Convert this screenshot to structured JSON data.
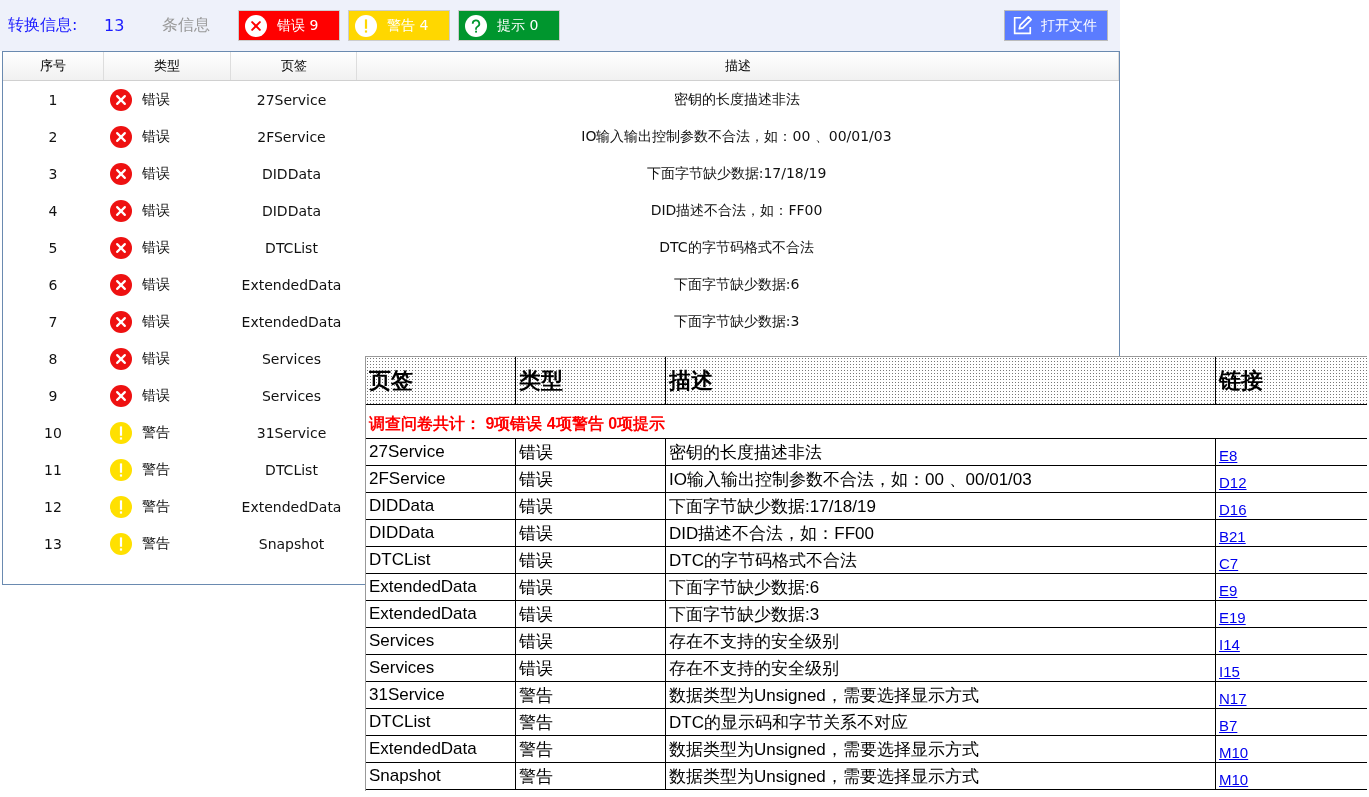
{
  "toolbar": {
    "label": "转换信息:",
    "count": "13",
    "count_label": "条信息",
    "badges": [
      {
        "kind": "error",
        "label": "错误 9"
      },
      {
        "kind": "warning",
        "label": "警告 4"
      },
      {
        "kind": "info",
        "label": "提示 0"
      }
    ],
    "open_button": "打开文件"
  },
  "table": {
    "columns": [
      "序号",
      "类型",
      "页签",
      "描述"
    ],
    "rows": [
      {
        "index": "1",
        "kind": "error",
        "type": "错误",
        "tab": "27Service",
        "description": "密钥的长度描述非法"
      },
      {
        "index": "2",
        "kind": "error",
        "type": "错误",
        "tab": "2FService",
        "description": "IO输入输出控制参数不合法，如：00 、00/01/03"
      },
      {
        "index": "3",
        "kind": "error",
        "type": "错误",
        "tab": "DIDData",
        "description": "下面字节缺少数据:17/18/19"
      },
      {
        "index": "4",
        "kind": "error",
        "type": "错误",
        "tab": "DIDData",
        "description": "DID描述不合法，如：FF00"
      },
      {
        "index": "5",
        "kind": "error",
        "type": "错误",
        "tab": "DTCList",
        "description": "DTC的字节码格式不合法"
      },
      {
        "index": "6",
        "kind": "error",
        "type": "错误",
        "tab": "ExtendedData",
        "description": "下面字节缺少数据:6"
      },
      {
        "index": "7",
        "kind": "error",
        "type": "错误",
        "tab": "ExtendedData",
        "description": "下面字节缺少数据:3"
      },
      {
        "index": "8",
        "kind": "error",
        "type": "错误",
        "tab": "Services"
      },
      {
        "index": "9",
        "kind": "error",
        "type": "错误",
        "tab": "Services"
      },
      {
        "index": "10",
        "kind": "warning",
        "type": "警告",
        "tab": "31Service"
      },
      {
        "index": "11",
        "kind": "warning",
        "type": "警告",
        "tab": "DTCList"
      },
      {
        "index": "12",
        "kind": "warning",
        "type": "警告",
        "tab": "ExtendedData"
      },
      {
        "index": "13",
        "kind": "warning",
        "type": "警告",
        "tab": "Snapshot"
      }
    ]
  },
  "sheet": {
    "columns": [
      "页签",
      "类型",
      "描述",
      "链接"
    ],
    "summary": "调查问卷共计： 9项错误 4项警告 0项提示",
    "rows": [
      {
        "tab": "27Service",
        "type": "错误",
        "description": "密钥的长度描述非法",
        "link": "E8"
      },
      {
        "tab": "2FService",
        "type": "错误",
        "description": "IO输入输出控制参数不合法，如：00 、00/01/03",
        "link": "D12"
      },
      {
        "tab": "DIDData",
        "type": "错误",
        "description": "下面字节缺少数据:17/18/19",
        "link": "D16"
      },
      {
        "tab": "DIDData",
        "type": "错误",
        "description": "DID描述不合法，如：FF00",
        "link": "B21"
      },
      {
        "tab": "DTCList",
        "type": "错误",
        "description": "DTC的字节码格式不合法",
        "link": "C7"
      },
      {
        "tab": "ExtendedData",
        "type": "错误",
        "description": "下面字节缺少数据:6",
        "link": "E9"
      },
      {
        "tab": "ExtendedData",
        "type": "错误",
        "description": "下面字节缺少数据:3",
        "link": "E19"
      },
      {
        "tab": "Services",
        "type": "错误",
        "description": "存在不支持的安全级别",
        "link": "I14"
      },
      {
        "tab": "Services",
        "type": "错误",
        "description": "存在不支持的安全级别",
        "link": "I15"
      },
      {
        "tab": "31Service",
        "type": "警告",
        "description": "数据类型为Unsigned，需要选择显示方式",
        "link": "N17"
      },
      {
        "tab": "DTCList",
        "type": "警告",
        "description": "DTC的显示码和字节关系不对应",
        "link": "B7"
      },
      {
        "tab": "ExtendedData",
        "type": "警告",
        "description": "数据类型为Unsigned，需要选择显示方式",
        "link": "M10"
      },
      {
        "tab": "Snapshot",
        "type": "警告",
        "description": "数据类型为Unsigned，需要选择显示方式",
        "link": "M10"
      }
    ]
  }
}
